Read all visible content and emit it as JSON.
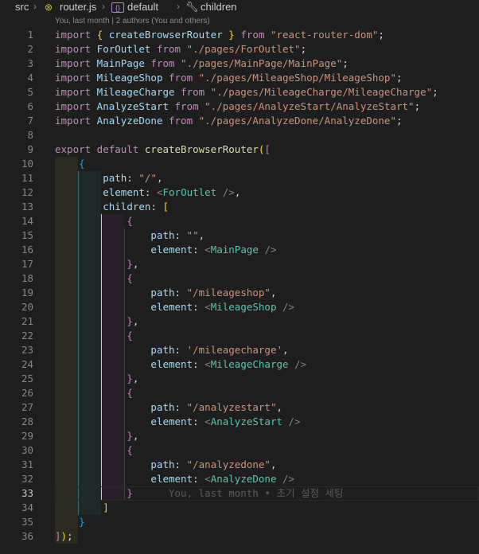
{
  "breadcrumb": {
    "folder": "src",
    "file": "router.js",
    "symbol1": "default",
    "symbol2": "children"
  },
  "codelens": "You, last month | 2 authors (You and others)",
  "current_line": 33,
  "blame": "You, last month • 초기 설정 세팅",
  "lines": [
    {
      "n": "1",
      "segs": [
        [
          "import",
          "kw"
        ],
        [
          " ",
          " "
        ],
        [
          "{",
          "b1"
        ],
        [
          " createBrowserRouter ",
          "var"
        ],
        [
          "}",
          "b1"
        ],
        [
          " from ",
          "kw"
        ],
        [
          "\"react-router-dom\"",
          "str"
        ],
        [
          ";",
          ""
        ]
      ]
    },
    {
      "n": "2",
      "segs": [
        [
          "import",
          "kw"
        ],
        [
          " ForOutlet ",
          "var"
        ],
        [
          "from",
          "kw"
        ],
        [
          " \"./pages/ForOutlet\"",
          "str"
        ],
        [
          ";",
          ""
        ]
      ]
    },
    {
      "n": "3",
      "segs": [
        [
          "import",
          "kw"
        ],
        [
          " MainPage ",
          "var"
        ],
        [
          "from",
          "kw"
        ],
        [
          " \"./pages/MainPage/MainPage\"",
          "str"
        ],
        [
          ";",
          ""
        ]
      ]
    },
    {
      "n": "4",
      "segs": [
        [
          "import",
          "kw"
        ],
        [
          " MileageShop ",
          "var"
        ],
        [
          "from",
          "kw"
        ],
        [
          " \"./pages/MileageShop/MileageShop\"",
          "str"
        ],
        [
          ";",
          ""
        ]
      ]
    },
    {
      "n": "5",
      "segs": [
        [
          "import",
          "kw"
        ],
        [
          " MileageCharge ",
          "var"
        ],
        [
          "from",
          "kw"
        ],
        [
          " \"./pages/MileageCharge/MileageCharge\"",
          "str"
        ],
        [
          ";",
          ""
        ]
      ]
    },
    {
      "n": "6",
      "segs": [
        [
          "import",
          "kw"
        ],
        [
          " AnalyzeStart ",
          "var"
        ],
        [
          "from",
          "kw"
        ],
        [
          " \"./pages/AnalyzeStart/AnalyzeStart\"",
          "str"
        ],
        [
          ";",
          ""
        ]
      ]
    },
    {
      "n": "7",
      "segs": [
        [
          "import",
          "kw"
        ],
        [
          " AnalyzeDone ",
          "var"
        ],
        [
          "from",
          "kw"
        ],
        [
          " \"./pages/AnalyzeDone/AnalyzeDone\"",
          "str"
        ],
        [
          ";",
          ""
        ]
      ]
    },
    {
      "n": "8",
      "segs": []
    },
    {
      "n": "9",
      "segs": [
        [
          "export",
          "kw"
        ],
        [
          " default ",
          "kw"
        ],
        [
          "createBrowserRouter",
          "fn"
        ],
        [
          "(",
          "b1"
        ],
        [
          "[",
          "b2"
        ]
      ]
    },
    {
      "n": "10",
      "segs": [
        [
          "    ",
          ""
        ],
        [
          "{",
          "b3"
        ]
      ]
    },
    {
      "n": "11",
      "segs": [
        [
          "        ",
          ""
        ],
        [
          "path",
          "var"
        ],
        [
          ": ",
          ""
        ],
        [
          "\"/\"",
          "str"
        ],
        [
          ",",
          ""
        ]
      ]
    },
    {
      "n": "12",
      "segs": [
        [
          "        ",
          ""
        ],
        [
          "element",
          "var"
        ],
        [
          ": ",
          ""
        ],
        [
          "<",
          "punc"
        ],
        [
          "ForOutlet",
          "tag"
        ],
        [
          " />",
          "punc"
        ],
        [
          ",",
          ""
        ]
      ]
    },
    {
      "n": "13",
      "segs": [
        [
          "        ",
          ""
        ],
        [
          "children",
          "var"
        ],
        [
          ": ",
          ""
        ],
        [
          "[",
          "b1"
        ]
      ]
    },
    {
      "n": "14",
      "segs": [
        [
          "            ",
          ""
        ],
        [
          "{",
          "b2"
        ]
      ]
    },
    {
      "n": "15",
      "segs": [
        [
          "                ",
          ""
        ],
        [
          "path",
          "var"
        ],
        [
          ": ",
          ""
        ],
        [
          "\"\"",
          "str"
        ],
        [
          ",",
          ""
        ]
      ]
    },
    {
      "n": "16",
      "segs": [
        [
          "                ",
          ""
        ],
        [
          "element",
          "var"
        ],
        [
          ": ",
          ""
        ],
        [
          "<",
          "punc"
        ],
        [
          "MainPage",
          "tag"
        ],
        [
          " />",
          "punc"
        ]
      ]
    },
    {
      "n": "17",
      "segs": [
        [
          "            ",
          ""
        ],
        [
          "}",
          "b2"
        ],
        [
          ",",
          ""
        ]
      ]
    },
    {
      "n": "18",
      "segs": [
        [
          "            ",
          ""
        ],
        [
          "{",
          "b2"
        ]
      ]
    },
    {
      "n": "19",
      "segs": [
        [
          "                ",
          ""
        ],
        [
          "path",
          "var"
        ],
        [
          ": ",
          ""
        ],
        [
          "\"/mileageshop\"",
          "str"
        ],
        [
          ",",
          ""
        ]
      ]
    },
    {
      "n": "20",
      "segs": [
        [
          "                ",
          ""
        ],
        [
          "element",
          "var"
        ],
        [
          ": ",
          ""
        ],
        [
          "<",
          "punc"
        ],
        [
          "MileageShop",
          "tag"
        ],
        [
          " />",
          "punc"
        ]
      ]
    },
    {
      "n": "21",
      "segs": [
        [
          "            ",
          ""
        ],
        [
          "}",
          "b2"
        ],
        [
          ",",
          ""
        ]
      ]
    },
    {
      "n": "22",
      "segs": [
        [
          "            ",
          ""
        ],
        [
          "{",
          "b2"
        ]
      ]
    },
    {
      "n": "23",
      "segs": [
        [
          "                ",
          ""
        ],
        [
          "path",
          "var"
        ],
        [
          ": ",
          ""
        ],
        [
          "'/mileagecharge'",
          "str"
        ],
        [
          ",",
          ""
        ]
      ]
    },
    {
      "n": "24",
      "segs": [
        [
          "                ",
          ""
        ],
        [
          "element",
          "var"
        ],
        [
          ": ",
          ""
        ],
        [
          "<",
          "punc"
        ],
        [
          "MileageCharge",
          "tag"
        ],
        [
          " />",
          "punc"
        ]
      ]
    },
    {
      "n": "25",
      "segs": [
        [
          "            ",
          ""
        ],
        [
          "}",
          "b2"
        ],
        [
          ",",
          ""
        ]
      ]
    },
    {
      "n": "26",
      "segs": [
        [
          "            ",
          ""
        ],
        [
          "{",
          "b2"
        ]
      ]
    },
    {
      "n": "27",
      "segs": [
        [
          "                ",
          ""
        ],
        [
          "path",
          "var"
        ],
        [
          ": ",
          ""
        ],
        [
          "\"/analyzestart\"",
          "str"
        ],
        [
          ",",
          ""
        ]
      ]
    },
    {
      "n": "28",
      "segs": [
        [
          "                ",
          ""
        ],
        [
          "element",
          "var"
        ],
        [
          ": ",
          ""
        ],
        [
          "<",
          "punc"
        ],
        [
          "AnalyzeStart",
          "tag"
        ],
        [
          " />",
          "punc"
        ]
      ]
    },
    {
      "n": "29",
      "segs": [
        [
          "            ",
          ""
        ],
        [
          "}",
          "b2"
        ],
        [
          ",",
          ""
        ]
      ]
    },
    {
      "n": "30",
      "segs": [
        [
          "            ",
          ""
        ],
        [
          "{",
          "b2"
        ]
      ]
    },
    {
      "n": "31",
      "segs": [
        [
          "                ",
          ""
        ],
        [
          "path",
          "var"
        ],
        [
          ": ",
          ""
        ],
        [
          "\"/analyzedone\"",
          "str"
        ],
        [
          ",",
          ""
        ]
      ]
    },
    {
      "n": "32",
      "segs": [
        [
          "                ",
          ""
        ],
        [
          "element",
          "var"
        ],
        [
          ": ",
          ""
        ],
        [
          "<",
          "punc"
        ],
        [
          "AnalyzeDone",
          "tag"
        ],
        [
          " />",
          "punc"
        ]
      ]
    },
    {
      "n": "33",
      "segs": [
        [
          "            ",
          ""
        ],
        [
          "}",
          "b2"
        ]
      ]
    },
    {
      "n": "34",
      "segs": [
        [
          "        ",
          ""
        ],
        [
          "]",
          "b1"
        ]
      ]
    },
    {
      "n": "35",
      "segs": [
        [
          "    ",
          ""
        ],
        [
          "}",
          "b3"
        ]
      ]
    },
    {
      "n": "36",
      "segs": [
        [
          "]",
          "b2"
        ],
        [
          ")",
          "b1"
        ],
        [
          ";",
          ""
        ]
      ]
    }
  ],
  "colors": {
    "background": "#1e1e1e",
    "keyword": "#c586c0",
    "string": "#ce9178",
    "variable": "#9cdcfe",
    "component": "#4ec9b0",
    "function": "#dcdcaa",
    "bracket_gold": "#ffd700",
    "bracket_orchid": "#da70d6",
    "bracket_blue": "#179fff"
  }
}
